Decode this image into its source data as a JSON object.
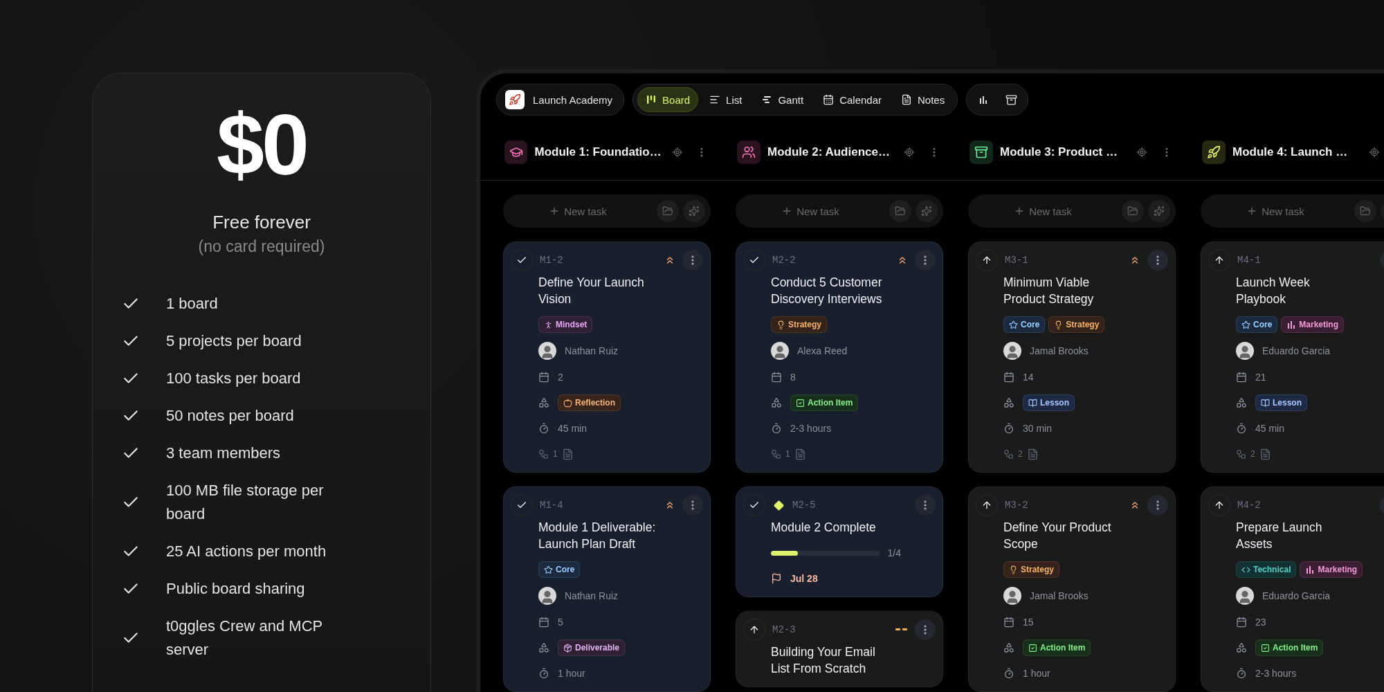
{
  "pricing": {
    "price": "$0",
    "plan": "Free forever",
    "note": "(no card required)",
    "features": [
      "1 board",
      "5 projects per board",
      "100 tasks per board",
      "50 notes per board",
      "3 team members",
      "100 MB file storage per board",
      "25 AI actions per month",
      "Public board sharing",
      "t0ggles Crew and MCP server"
    ]
  },
  "app": {
    "board_name": "Launch Academy",
    "views": [
      {
        "label": "Board",
        "selected": true
      },
      {
        "label": "List",
        "selected": false
      },
      {
        "label": "Gantt",
        "selected": false
      },
      {
        "label": "Calendar",
        "selected": false
      },
      {
        "label": "Notes",
        "selected": false
      }
    ],
    "columns": [
      {
        "title": "Module 1: Foundatio…",
        "color": "#f472b6",
        "new_task": "New task",
        "cards": [
          {
            "id": "M1-2",
            "done": true,
            "priority": {
              "kind": "high"
            },
            "title": "Define Your Launch Vision",
            "tags": [
              {
                "label": "Mindset",
                "kind": "mindset"
              }
            ],
            "assignee": "Nathan Ruiz",
            "day": "2",
            "type": {
              "label": "Reflection",
              "kind": "reflection"
            },
            "duration": "45 min",
            "subtasks": "1",
            "notes": true
          },
          {
            "id": "M1-4",
            "done": true,
            "priority": {
              "kind": "high"
            },
            "title": "Module 1 Deliverable: Launch Plan Draft",
            "tags": [
              {
                "label": "Core",
                "kind": "core"
              }
            ],
            "assignee": "Nathan Ruiz",
            "day": "5",
            "type": {
              "label": "Deliverable",
              "kind": "deliverable"
            },
            "duration": "1 hour"
          }
        ]
      },
      {
        "title": "Module 2: Audience…",
        "color": "#f472b6",
        "new_task": "New task",
        "cards": [
          {
            "id": "M2-2",
            "done": true,
            "priority": {
              "kind": "high"
            },
            "title": "Conduct 5 Customer Discovery Interviews",
            "tags": [
              {
                "label": "Strategy",
                "kind": "strategy"
              }
            ],
            "assignee": "Alexa Reed",
            "day": "8",
            "type": {
              "label": "Action Item",
              "kind": "action"
            },
            "duration": "2-3 hours",
            "subtasks": "1",
            "notes": true
          },
          {
            "id": "M2-5",
            "done": true,
            "milestone": true,
            "title": "Module 2 Complete",
            "progress": {
              "level": 0.25,
              "reading": "1/4"
            },
            "due": "Jul 28"
          },
          {
            "id": "M2-3",
            "done": false,
            "priority": {
              "kind": "medium"
            },
            "title": "Building Your Email List From Scratch"
          }
        ]
      },
      {
        "title": "Module 3: Product …",
        "color": "#6ee7a0",
        "new_task": "New task",
        "cards": [
          {
            "id": "M3-1",
            "done": false,
            "priority": {
              "kind": "high"
            },
            "title": "Minimum Viable Product Strategy",
            "tags": [
              {
                "label": "Core",
                "kind": "core"
              },
              {
                "label": "Strategy",
                "kind": "strategy"
              }
            ],
            "assignee": "Jamal Brooks",
            "day": "14",
            "type": {
              "label": "Lesson",
              "kind": "lesson"
            },
            "duration": "30 min",
            "subtasks": "2",
            "notes": true
          },
          {
            "id": "M3-2",
            "done": false,
            "priority": {
              "kind": "high"
            },
            "title": "Define Your Product Scope",
            "tags": [
              {
                "label": "Strategy",
                "kind": "strategy"
              }
            ],
            "assignee": "Jamal Brooks",
            "day": "15",
            "type": {
              "label": "Action Item",
              "kind": "action"
            },
            "duration": "1 hour"
          }
        ]
      },
      {
        "title": "Module 4: Launch …",
        "color": "#e5f26b",
        "new_task": "New task",
        "cards": [
          {
            "id": "M4-1",
            "done": false,
            "title": "Launch Week Playbook",
            "tags": [
              {
                "label": "Core",
                "kind": "core"
              },
              {
                "label": "Marketing",
                "kind": "marketing"
              }
            ],
            "assignee": "Eduardo Garcia",
            "day": "21",
            "type": {
              "label": "Lesson",
              "kind": "lesson"
            },
            "duration": "45 min",
            "subtasks": "2",
            "notes": true
          },
          {
            "id": "M4-2",
            "done": false,
            "title": "Prepare Launch Assets",
            "tags": [
              {
                "label": "Technical",
                "kind": "technical"
              },
              {
                "label": "Marketing",
                "kind": "marketing"
              }
            ],
            "assignee": "Eduardo Garcia",
            "day": "23",
            "type": {
              "label": "Action Item",
              "kind": "action"
            },
            "duration": "2-3 hours"
          }
        ]
      }
    ]
  }
}
